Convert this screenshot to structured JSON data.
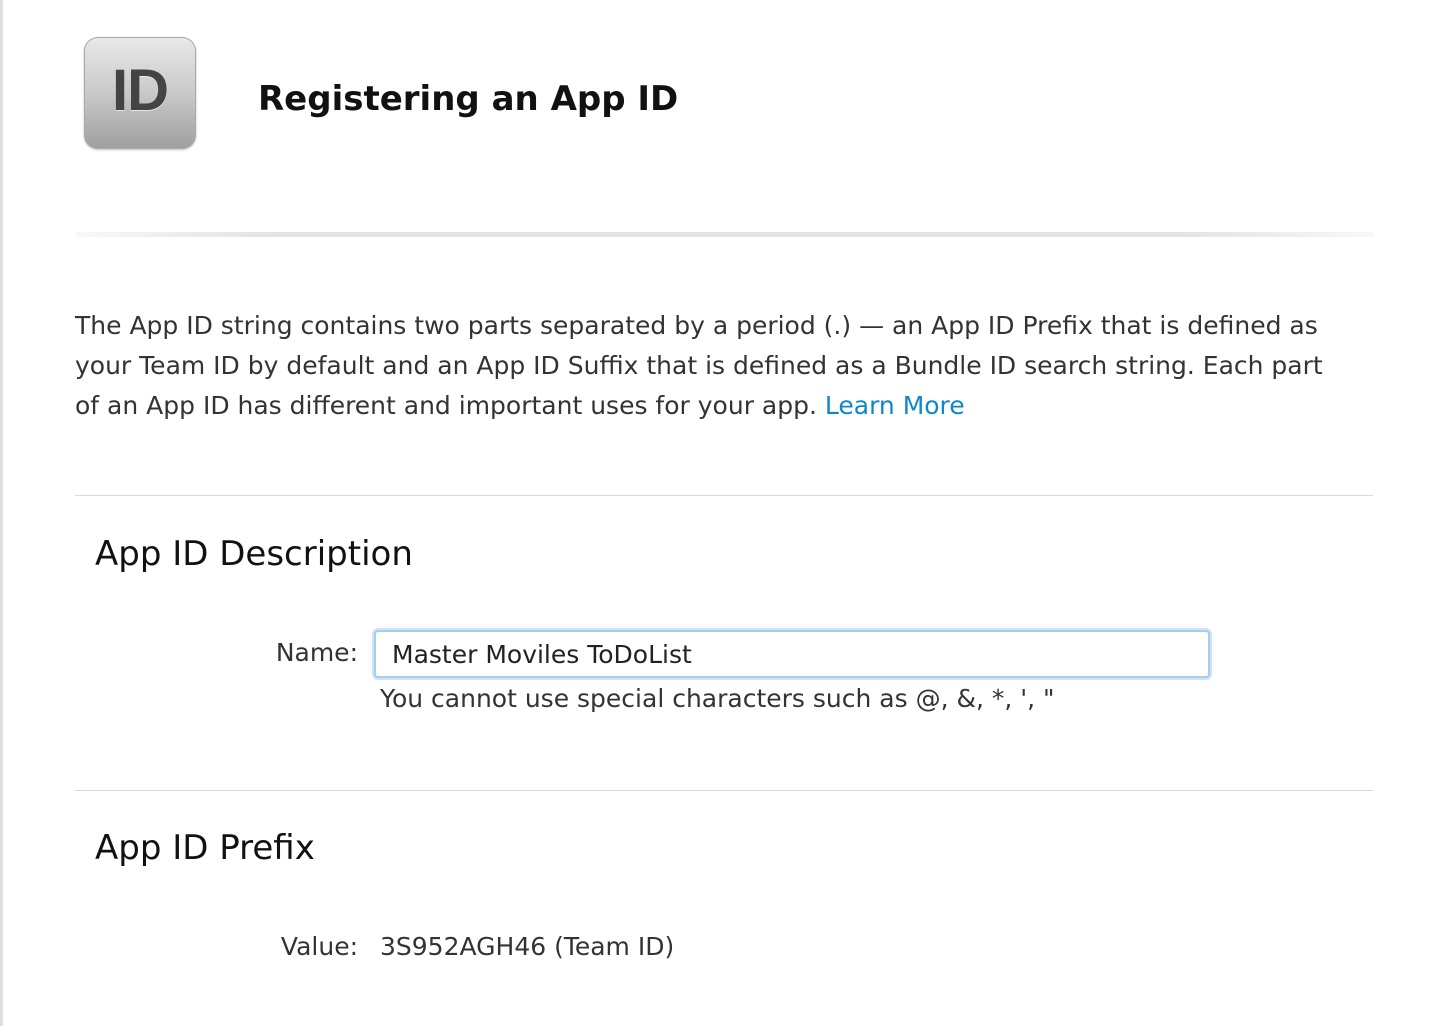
{
  "header": {
    "icon_text": "ID",
    "title": "Registering an App ID"
  },
  "intro": {
    "text": "The App ID string contains two parts separated by a period (.) — an App ID Prefix that is defined as your Team ID by default and an App ID Suffix that is defined as a Bundle ID search string. Each part of an App ID has different and important uses for your app.",
    "link_label": "Learn More"
  },
  "description_section": {
    "title": "App ID Description",
    "name_label": "Name:",
    "name_value": "Master Moviles ToDoList",
    "hint": "You cannot use special characters such as @, &, *, ', \""
  },
  "prefix_section": {
    "title": "App ID Prefix",
    "value_label": "Value:",
    "value": "3S952AGH46 (Team ID)"
  },
  "colors": {
    "link": "#0e88c8",
    "input_focus_border": "#a9cbec"
  }
}
